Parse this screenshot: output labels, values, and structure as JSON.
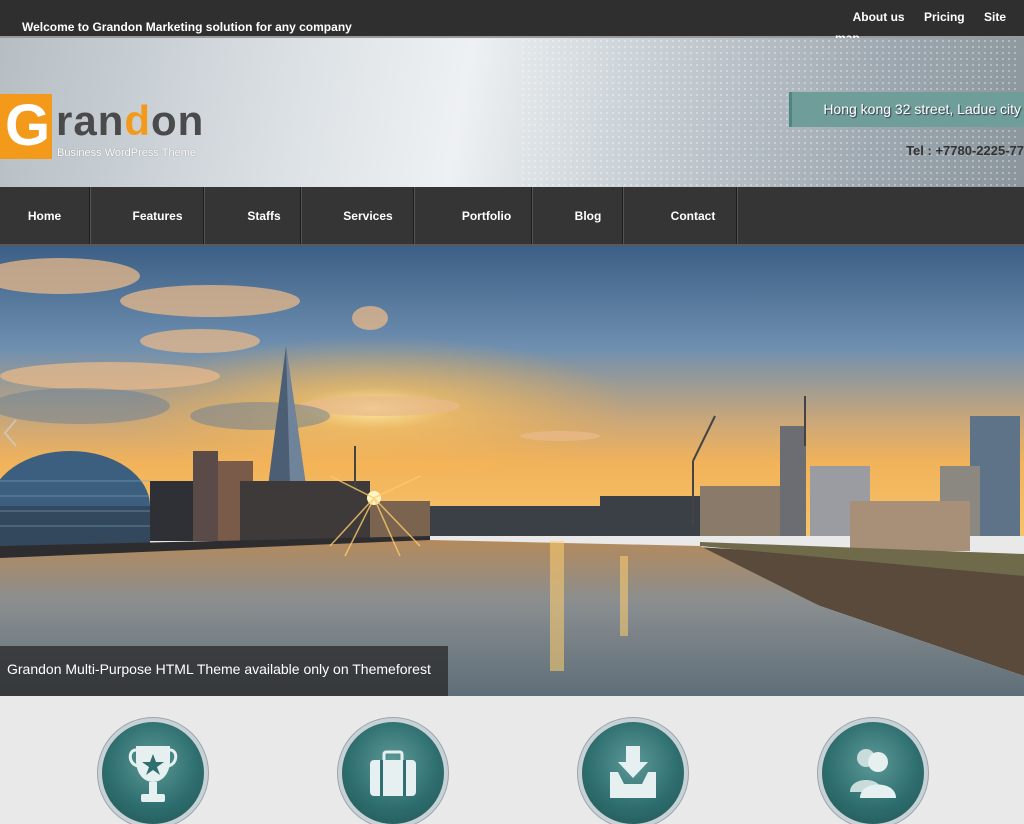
{
  "topbar": {
    "welcome": "Welcome to Grandon Marketing solution for any company",
    "links": [
      "About us",
      "Pricing",
      "Site",
      "map"
    ]
  },
  "header": {
    "logo_initial": "G",
    "logo_dark_1": "ran",
    "logo_orange": "d",
    "logo_dark_2": "on",
    "tagline": "Business WordPress Theme",
    "address": "Hong kong 32 street, Ladue city",
    "tel": "Tel : +7780-2225-77"
  },
  "nav": {
    "items": [
      "Home",
      "Features",
      "Staffs",
      "Services",
      "Portfolio",
      "Blog",
      "Contact"
    ]
  },
  "hero": {
    "caption": "Grandon Multi-Purpose HTML Theme available only on Themeforest",
    "prev_icon": "chevron-left-icon"
  },
  "features": {
    "icons": [
      "trophy-icon",
      "briefcase-icon",
      "download-tray-icon",
      "users-icon"
    ]
  },
  "colors": {
    "accent": "#f39a1b",
    "nav_bg": "#353535",
    "address_bg": "#6e9d9a",
    "icon_teal": "#2f6f6f"
  }
}
